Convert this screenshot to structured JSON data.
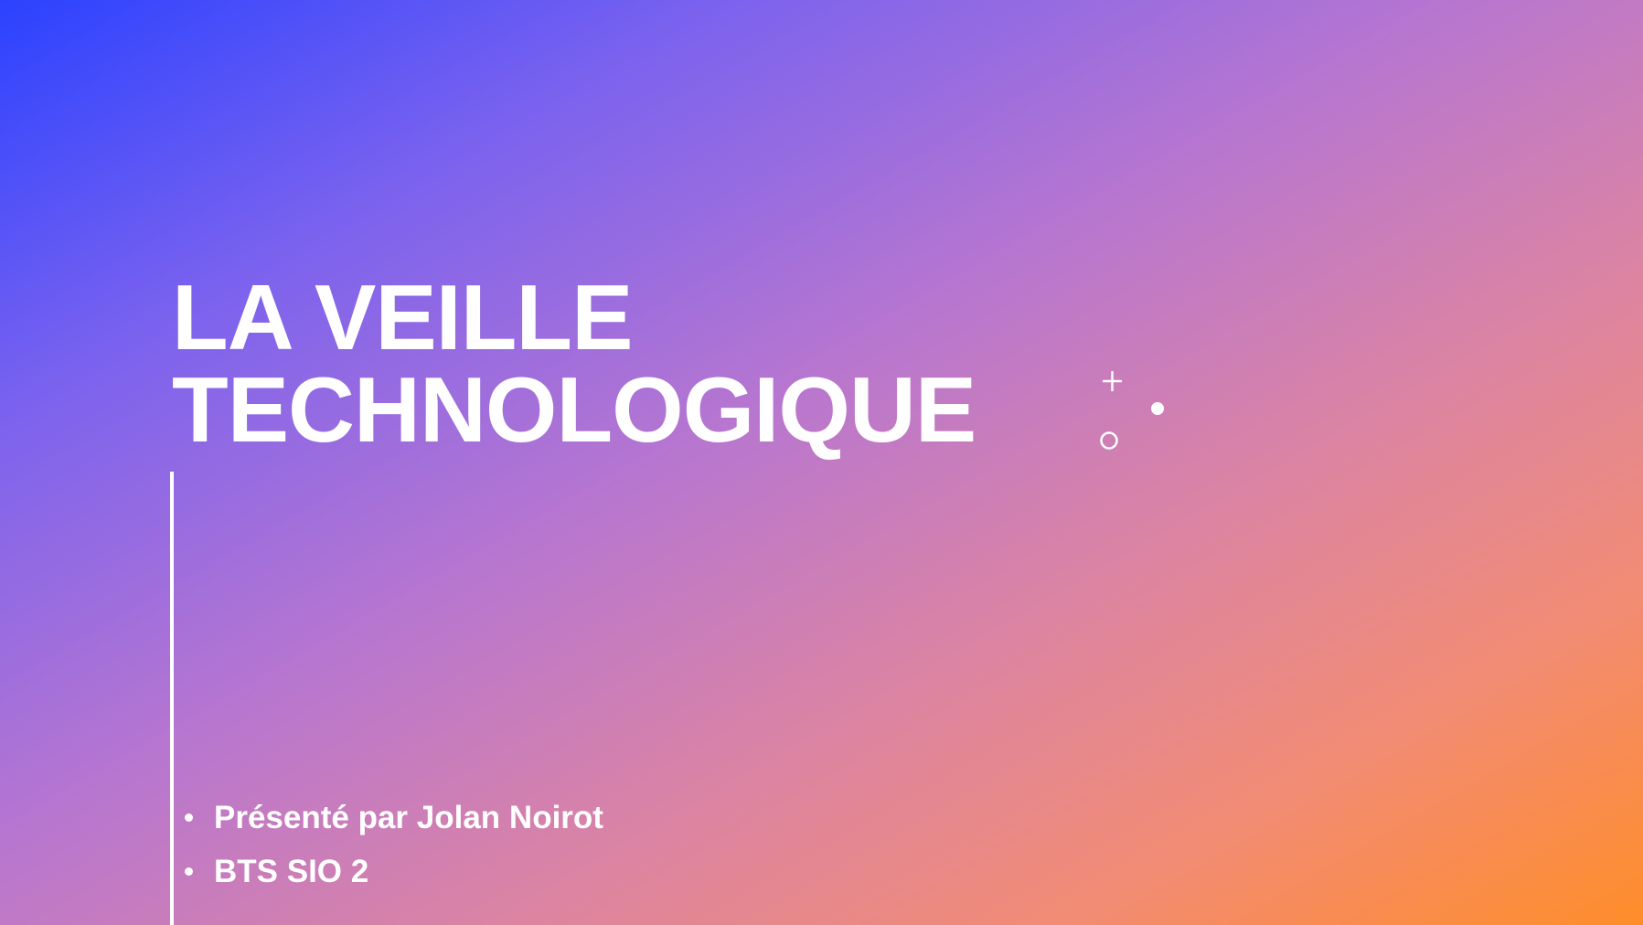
{
  "slide": {
    "title_lines": [
      "LA VEILLE",
      "TECHNOLOGIQUE"
    ],
    "bullets": [
      "Présenté par Jolan Noirot",
      "BTS SIO 2"
    ],
    "colors": {
      "gradient_start": "#2b42ff",
      "gradient_end": "#ff8d2a",
      "text": "#ffffff"
    },
    "decorations": [
      "plus-icon",
      "filled-dot-icon",
      "ring-icon"
    ]
  }
}
